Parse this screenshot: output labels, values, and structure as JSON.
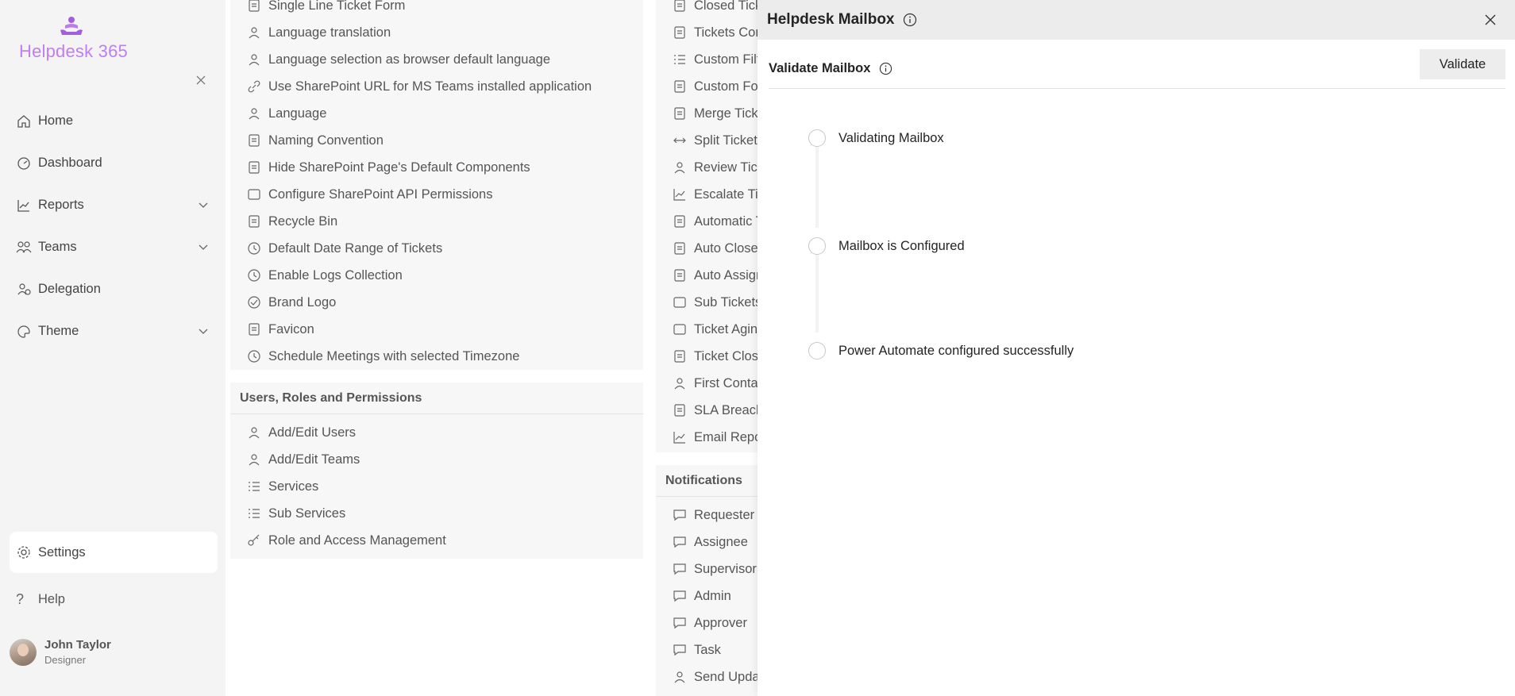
{
  "app": {
    "name": "Helpdesk 365",
    "brand_color": "#c07ef0"
  },
  "sidebar": {
    "collapse_icon": "close-icon",
    "items": [
      {
        "label": "Home",
        "icon": "home-icon",
        "has_chevron": false
      },
      {
        "label": "Dashboard",
        "icon": "dashboard-icon",
        "has_chevron": false
      },
      {
        "label": "Reports",
        "icon": "chart-line-icon",
        "has_chevron": true
      },
      {
        "label": "Teams",
        "icon": "people-team-icon",
        "has_chevron": true
      },
      {
        "label": "Delegation",
        "icon": "delegation-icon",
        "has_chevron": false
      },
      {
        "label": "Theme",
        "icon": "palette-icon",
        "has_chevron": true
      }
    ],
    "settings_label": "Settings",
    "help_label": "Help",
    "user": {
      "name": "John Taylor",
      "role": "Designer"
    }
  },
  "settings_col1": {
    "general_items": [
      "Single Line Ticket Form",
      "Language translation",
      "Language selection as browser default language",
      "Use SharePoint URL for MS Teams installed application",
      "Language",
      "Naming Convention",
      "Hide SharePoint Page's Default Components",
      "Configure SharePoint API Permissions",
      "Recycle Bin",
      "Default Date Range of Tickets",
      "Enable Logs Collection",
      "Brand Logo",
      "Favicon",
      "Schedule Meetings with selected Timezone"
    ],
    "users_heading": "Users, Roles and Permissions",
    "users_items": [
      "Add/Edit Users",
      "Add/Edit Teams",
      "Services",
      "Sub Services",
      "Role and Access Management"
    ]
  },
  "settings_col2": {
    "ticket_items": [
      "Closed Ticke",
      "Tickets Com",
      "Custom Filte",
      "Custom For",
      "Merge Ticke",
      "Split Tickets",
      "Review Ticke",
      "Escalate Tick",
      "Automatic T",
      "Auto Close T",
      "Auto Assign",
      "Sub Tickets",
      "Ticket Aging",
      "Ticket Closu",
      "First Contac",
      "SLA Breach",
      "Email Repor"
    ],
    "notifications_heading": "Notifications",
    "notification_items": [
      "Requester",
      "Assignee",
      "Supervisor",
      "Admin",
      "Approver",
      "Task",
      "Send Updat"
    ]
  },
  "dialog": {
    "title": "Helpdesk Mailbox",
    "validate_section_title": "Validate Mailbox",
    "validate_button": "Validate",
    "steps": [
      "Validating Mailbox",
      "Mailbox is Configured",
      "Power Automate configured successfully"
    ]
  }
}
